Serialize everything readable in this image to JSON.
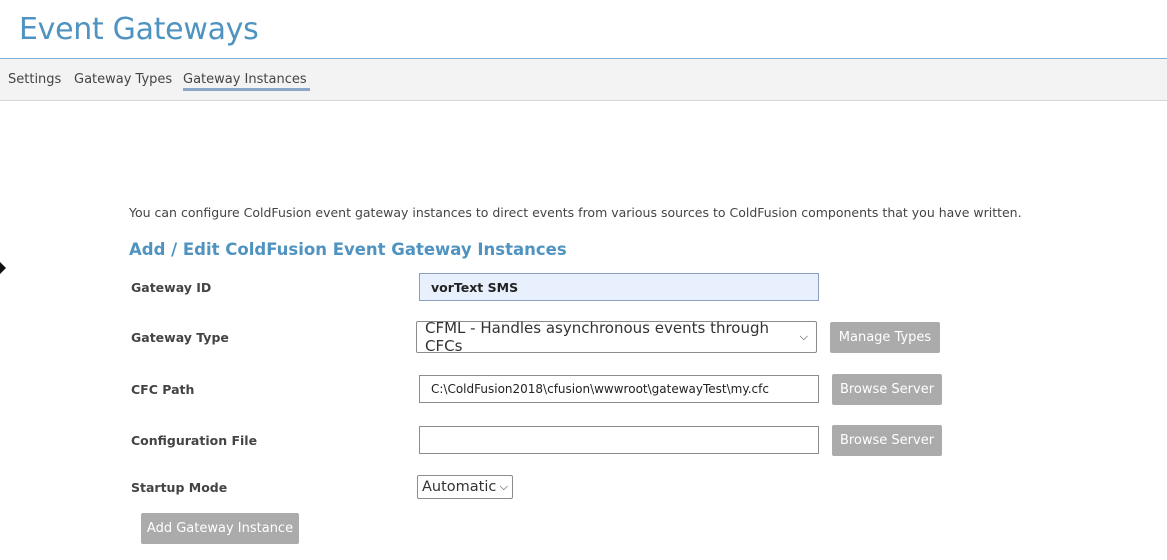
{
  "page": {
    "title": "Event Gateways"
  },
  "tabs": [
    {
      "label": "Settings"
    },
    {
      "label": "Gateway Types"
    },
    {
      "label": "Gateway Instances",
      "active": true
    }
  ],
  "intro": "You can configure ColdFusion event gateway instances to direct events from various sources to ColdFusion components that you have written.",
  "section_title": "Add / Edit ColdFusion Event Gateway Instances",
  "form": {
    "gateway_id": {
      "label": "Gateway ID",
      "value": "vorText SMS"
    },
    "gateway_type": {
      "label": "Gateway Type",
      "value": "CFML - Handles asynchronous events through CFCs",
      "button": "Manage Types"
    },
    "cfc_path": {
      "label": "CFC Path",
      "value": "C:\\ColdFusion2018\\cfusion\\wwwroot\\gatewayTest\\my.cfc",
      "button": "Browse Server"
    },
    "config_file": {
      "label": "Configuration File",
      "value": "",
      "button": "Browse Server"
    },
    "startup_mode": {
      "label": "Startup Mode",
      "value": "Automatic"
    },
    "submit": "Add Gateway Instance"
  },
  "colors": {
    "accent": "#4f93c0",
    "button": "#ababab",
    "tab_underline": "#8aa6c9"
  }
}
